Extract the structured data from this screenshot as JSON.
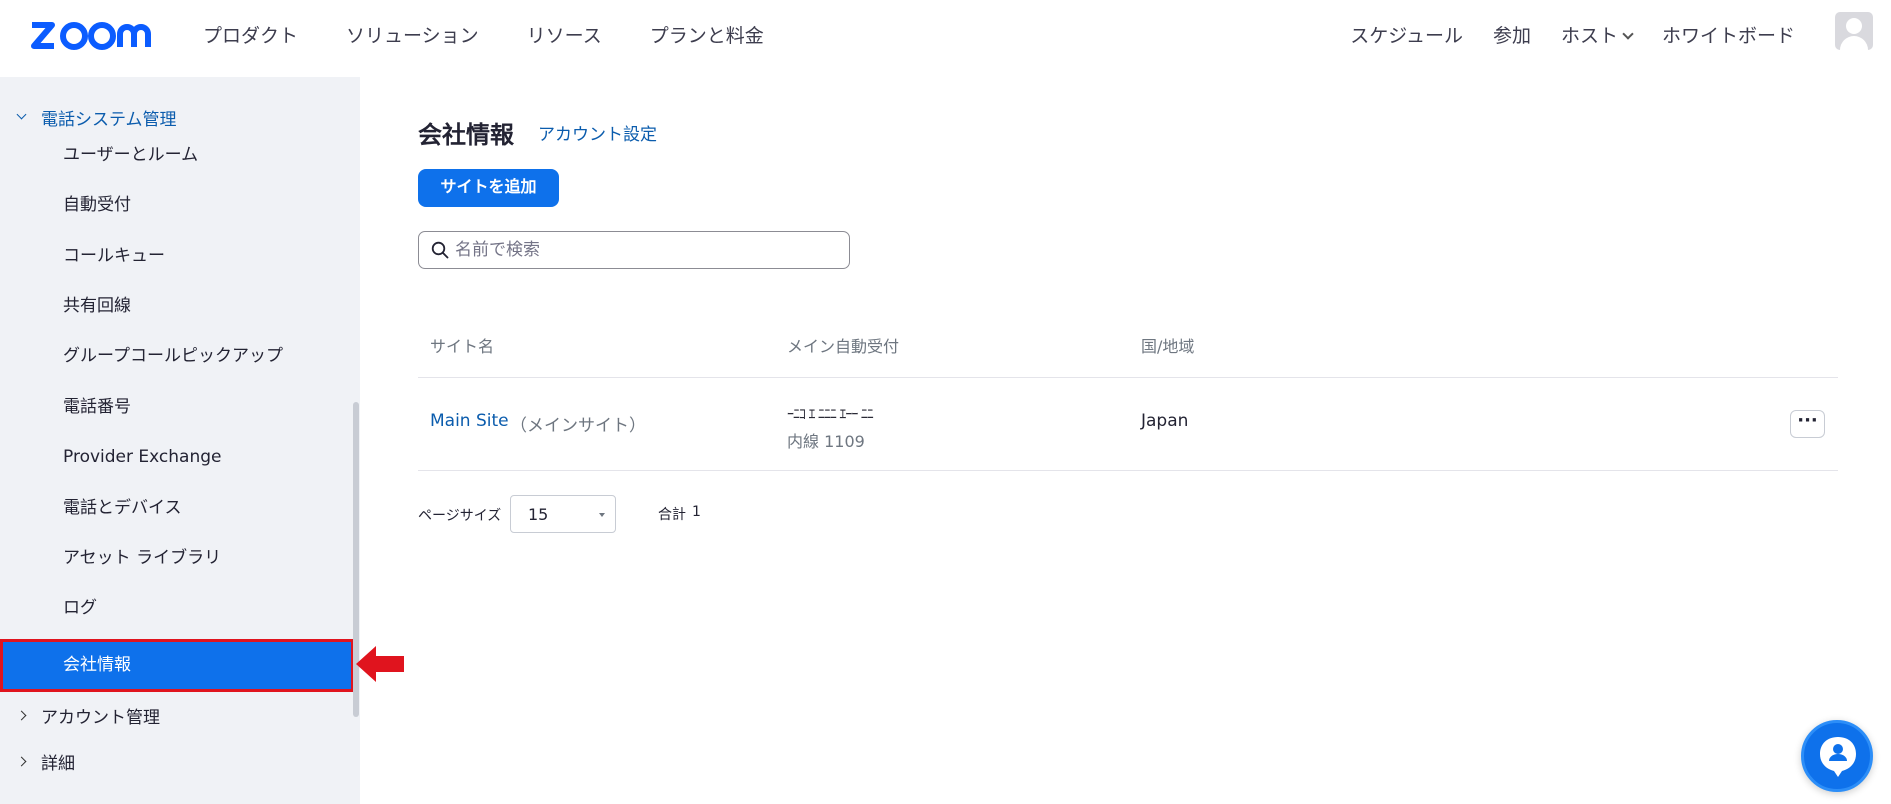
{
  "brand": {
    "logo_text": "zoom",
    "brand_color": "#0b5cff"
  },
  "nav": {
    "left": [
      "プロダクト",
      "ソリューション",
      "リソース",
      "プランと料金"
    ],
    "right": {
      "schedule": "スケジュール",
      "join": "参加",
      "host": "ホスト",
      "whiteboard": "ホワイトボード"
    }
  },
  "sidebar": {
    "group_open": "電話システム管理",
    "items": [
      "ユーザーとルーム",
      "自動受付",
      "コールキュー",
      "共有回線",
      "グループコールピックアップ",
      "電話番号",
      "Provider Exchange",
      "電話とデバイス",
      "アセット ライブラリ",
      "ログ"
    ],
    "active_item": "会社情報",
    "group_account": "アカウント管理",
    "group_advanced": "詳細"
  },
  "main": {
    "title": "会社情報",
    "account_settings_link": "アカウント設定",
    "add_site_button": "サイトを追加",
    "search_placeholder": "名前で検索",
    "table": {
      "headers": {
        "site_name": "サイト名",
        "main_auto_receptionist": "メイン自動受付",
        "country": "国/地域"
      },
      "rows": [
        {
          "site": "Main Site",
          "site_note": "（メインサイト）",
          "receptionist_name": "ｰﾆｺ ｴ ﾆﾆﾆ ｴｰｰ ﾆﾆ",
          "extension": "内線 1109",
          "country": "Japan",
          "more": "···"
        }
      ]
    },
    "pagination": {
      "page_size_label": "ページサイズ",
      "page_size": "15",
      "total_label": "合計",
      "total": "1"
    }
  },
  "colors": {
    "accent": "#0e71eb",
    "link": "#0b5cad",
    "highlight_border": "#e0141e"
  }
}
